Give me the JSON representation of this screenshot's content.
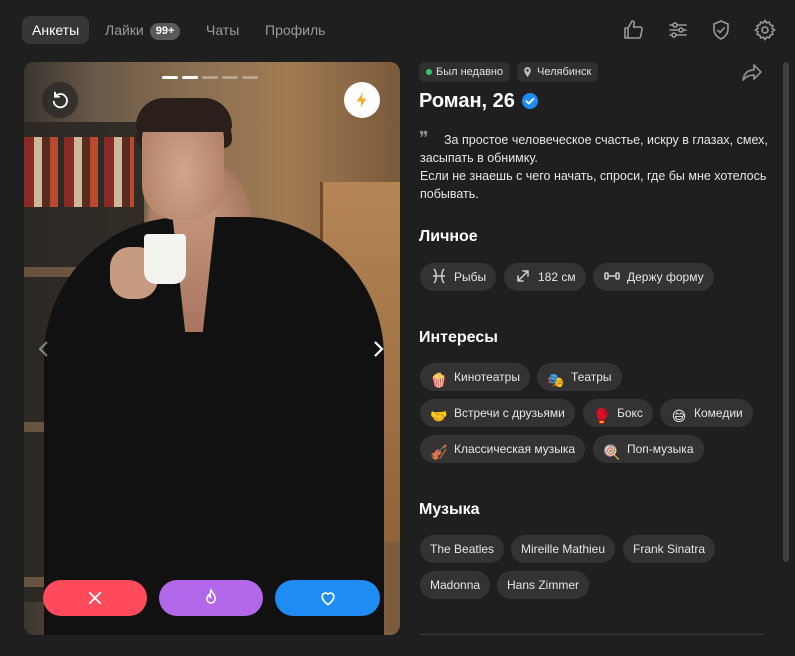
{
  "nav": {
    "tabs": [
      {
        "label": "Анкеты"
      },
      {
        "label": "Лайки",
        "badge": "99+"
      },
      {
        "label": "Чаты"
      },
      {
        "label": "Профиль"
      }
    ],
    "icons": [
      "thumbs-up-icon",
      "sliders-icon",
      "shield-check-icon",
      "gear-icon"
    ]
  },
  "photo": {
    "dots_total": 5,
    "dots_active": [
      0,
      1
    ]
  },
  "profile": {
    "status": "Был недавно",
    "city": "Челябинск",
    "name": "Роман, 26",
    "bio": "За простое человеческое счастье, искру в глазах, смех, засыпать в обнимку.\nЕсли не знаешь с чего начать, спроси, где бы мне хотелось побывать."
  },
  "sections": {
    "personal": {
      "title": "Личное",
      "items": [
        {
          "label": "Рыбы",
          "icon": "pisces-icon"
        },
        {
          "label": "182 см",
          "icon": "expand-icon"
        },
        {
          "label": "Держу форму",
          "icon": "dumbbell-icon"
        }
      ]
    },
    "interests": {
      "title": "Интересы",
      "items": [
        {
          "label": "Кинотеатры",
          "emoji": "🍿"
        },
        {
          "label": "Театры",
          "emoji": "🎭"
        },
        {
          "label": "Встречи с друзьями",
          "emoji": "🤝"
        },
        {
          "label": "Бокс",
          "emoji": "🥊"
        },
        {
          "label": "Комедии",
          "emoji": "😅"
        },
        {
          "label": "Классическая музыка",
          "emoji": "🎻"
        },
        {
          "label": "Поп-музыка",
          "emoji": "🍭"
        }
      ]
    },
    "music": {
      "title": "Музыка",
      "items": [
        {
          "label": "The Beatles"
        },
        {
          "label": "Mireille Mathieu"
        },
        {
          "label": "Frank Sinatra"
        },
        {
          "label": "Madonna"
        },
        {
          "label": "Hans Zimmer"
        }
      ]
    }
  },
  "colors": {
    "background": "#1f1f1f",
    "dislike": "#ff4b5c",
    "superlike": "#b268e8",
    "like": "#1e8cf2",
    "online": "#34c759",
    "verified": "#1e8cf2"
  }
}
